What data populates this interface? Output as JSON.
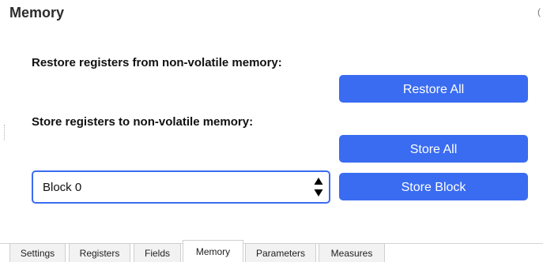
{
  "panel": {
    "title": "Memory",
    "corner_mark": "("
  },
  "restore": {
    "label": "Restore registers from non-volatile memory:",
    "button": "Restore All"
  },
  "store": {
    "label": "Store registers to non-volatile memory:",
    "store_all_button": "Store All",
    "block_select_value": "Block 0",
    "store_block_button": "Store Block"
  },
  "tabs": [
    {
      "label": "Settings"
    },
    {
      "label": "Registers"
    },
    {
      "label": "Fields"
    },
    {
      "label": "Memory",
      "active": true
    },
    {
      "label": "Parameters"
    },
    {
      "label": "Measures"
    }
  ],
  "colors": {
    "accent": "#3a6cf1"
  }
}
